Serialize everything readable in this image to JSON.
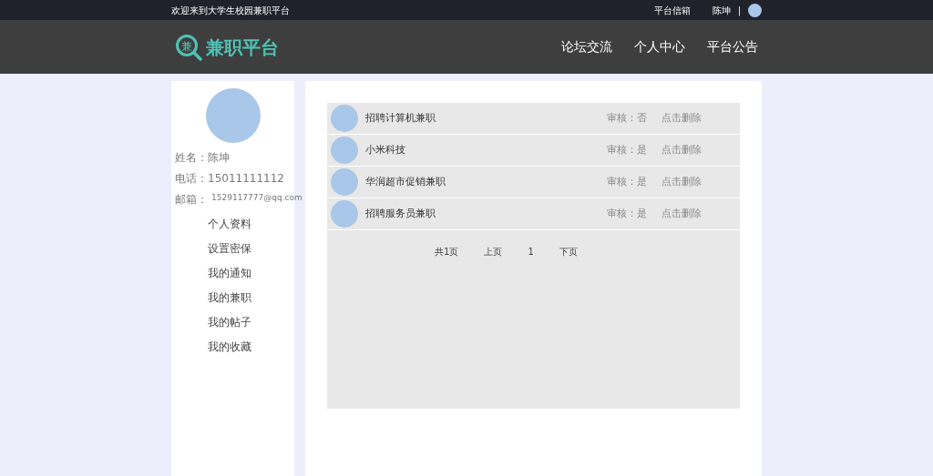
{
  "top_bar": {
    "welcome": "欢迎来到大学生校园兼职平台",
    "mailbox": "平台信箱",
    "user": "陈坤",
    "separator": "|"
  },
  "header": {
    "logo_glyph": "兼",
    "logo_text": "兼职平台",
    "nav": [
      {
        "label": "论坛交流"
      },
      {
        "label": "个人中心"
      },
      {
        "label": "平台公告"
      }
    ]
  },
  "profile": {
    "fields": [
      {
        "label": "姓名：",
        "value": "陈坤",
        "kind": "normal"
      },
      {
        "label": "电话：",
        "value": "15011111112",
        "kind": "normal"
      },
      {
        "label": "邮箱：",
        "value": "1529117777@qq.com",
        "kind": "small"
      }
    ],
    "menu": [
      {
        "label": "个人资料"
      },
      {
        "label": "设置密保"
      },
      {
        "label": "我的通知"
      },
      {
        "label": "我的兼职"
      },
      {
        "label": "我的帖子"
      },
      {
        "label": "我的收藏"
      }
    ]
  },
  "jobs": [
    {
      "title": "招聘计算机兼职",
      "audit": "审核：否",
      "action": "点击删除"
    },
    {
      "title": "小米科技",
      "audit": "审核：是",
      "action": "点击删除"
    },
    {
      "title": "华润超市促销兼职",
      "audit": "审核：是",
      "action": "点击删除"
    },
    {
      "title": "招聘服务员兼职",
      "audit": "审核：是",
      "action": "点击删除"
    }
  ],
  "pagination": {
    "total": "共1页",
    "prev": "上页",
    "page": "1",
    "next": "下页"
  }
}
